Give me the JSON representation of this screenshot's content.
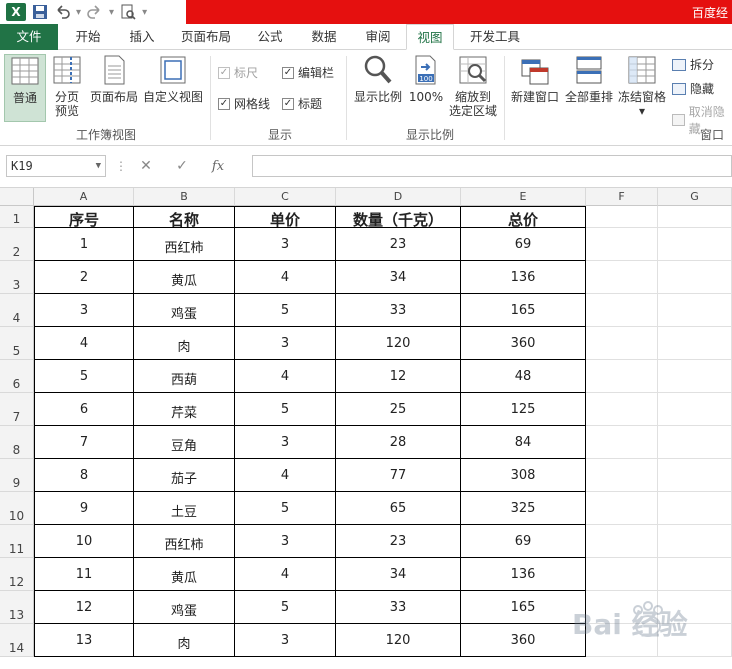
{
  "title_bar": {
    "document_title": "百度经",
    "qat_icons": [
      "excel-icon",
      "save-icon",
      "undo-icon",
      "redo-icon",
      "print-preview-icon",
      "customize-icon"
    ]
  },
  "tabs": [
    {
      "label": "文件",
      "state": "file"
    },
    {
      "label": "开始"
    },
    {
      "label": "插入"
    },
    {
      "label": "页面布局"
    },
    {
      "label": "公式"
    },
    {
      "label": "数据"
    },
    {
      "label": "审阅"
    },
    {
      "label": "视图",
      "state": "active"
    },
    {
      "label": "开发工具"
    }
  ],
  "ribbon": {
    "workbook_views": {
      "label": "工作簿视图",
      "normal": "普通",
      "page_break_l1": "分页",
      "page_break_l2": "预览",
      "page_layout": "页面布局",
      "custom_views": "自定义视图"
    },
    "show": {
      "label": "显示",
      "ruler": "标尺",
      "formula_bar": "编辑栏",
      "gridlines": "网格线",
      "headings": "标题"
    },
    "zoom": {
      "label": "显示比例",
      "zoom": "显示比例",
      "hundred": "100%",
      "zoom_sel_l1": "缩放到",
      "zoom_sel_l2": "选定区域"
    },
    "window": {
      "label": "窗口",
      "new_window": "新建窗口",
      "arrange_all": "全部重排",
      "freeze_panes": "冻结窗格",
      "split": "拆分",
      "hide": "隐藏",
      "unhide": "取消隐藏"
    }
  },
  "formula_bar": {
    "name_box": "K19",
    "cancel": "✕",
    "enter": "✓",
    "fx": "fx",
    "value": ""
  },
  "sheet": {
    "columns": [
      "A",
      "B",
      "C",
      "D",
      "E",
      "F",
      "G"
    ],
    "headers": [
      "序号",
      "名称",
      "单价",
      "数量（千克）",
      "总价"
    ],
    "rows": [
      [
        "1",
        "西红柿",
        "3",
        "23",
        "69"
      ],
      [
        "2",
        "黄瓜",
        "4",
        "34",
        "136"
      ],
      [
        "3",
        "鸡蛋",
        "5",
        "33",
        "165"
      ],
      [
        "4",
        "肉",
        "3",
        "120",
        "360"
      ],
      [
        "5",
        "西葫",
        "4",
        "12",
        "48"
      ],
      [
        "6",
        "芹菜",
        "5",
        "25",
        "125"
      ],
      [
        "7",
        "豆角",
        "3",
        "28",
        "84"
      ],
      [
        "8",
        "茄子",
        "4",
        "77",
        "308"
      ],
      [
        "9",
        "土豆",
        "5",
        "65",
        "325"
      ],
      [
        "10",
        "西红柿",
        "3",
        "23",
        "69"
      ],
      [
        "11",
        "黄瓜",
        "4",
        "34",
        "136"
      ],
      [
        "12",
        "鸡蛋",
        "5",
        "33",
        "165"
      ],
      [
        "13",
        "肉",
        "3",
        "120",
        "360"
      ]
    ],
    "row_numbers": [
      "1",
      "2",
      "3",
      "4",
      "5",
      "6",
      "7",
      "8",
      "9",
      "10",
      "11",
      "12",
      "13",
      "14"
    ]
  },
  "watermark": {
    "text": "Bai 经验"
  }
}
